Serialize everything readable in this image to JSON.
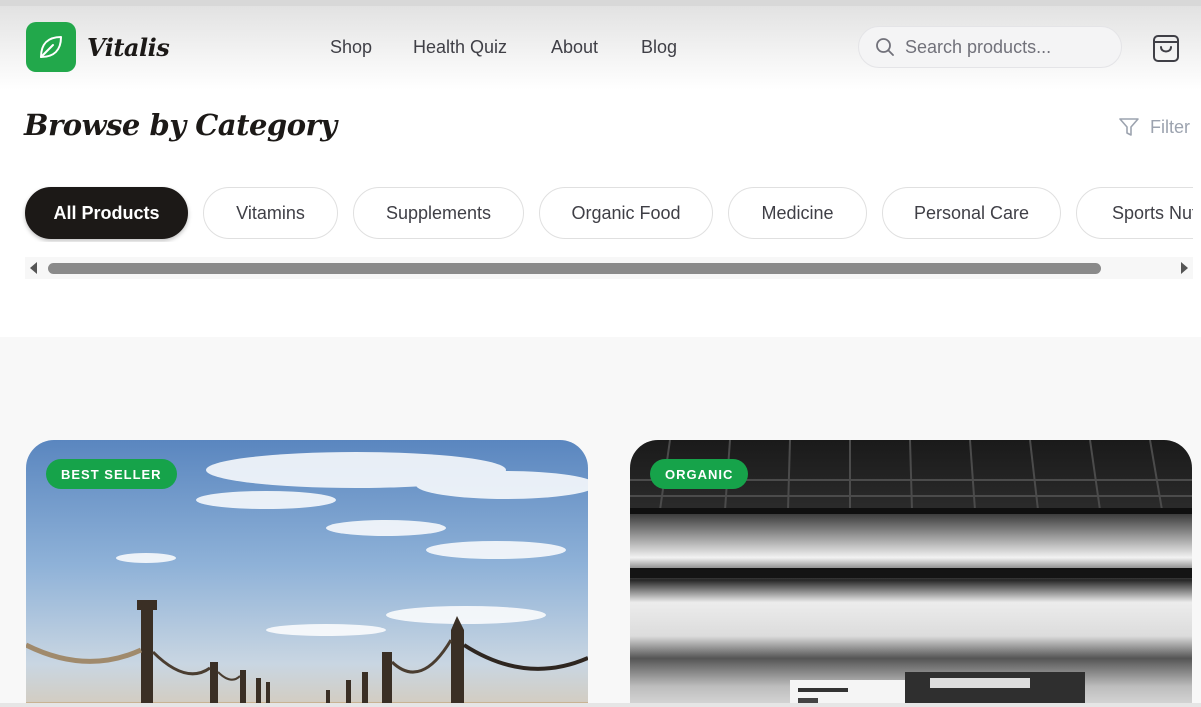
{
  "brand": {
    "name": "Vitalis",
    "logo_icon": "leaf-icon",
    "logo_color": "#22a84b"
  },
  "nav": {
    "items": [
      "Shop",
      "Health Quiz",
      "About",
      "Blog"
    ]
  },
  "search": {
    "placeholder": "Search products...",
    "value": "",
    "icon": "search-icon"
  },
  "cart": {
    "icon": "shopping-bag-icon"
  },
  "page": {
    "title": "Browse by Category"
  },
  "filter": {
    "label": "Filter",
    "icon": "funnel-icon"
  },
  "categories": {
    "items": [
      "All Products",
      "Vitamins",
      "Supplements",
      "Organic Food",
      "Medicine",
      "Personal Care",
      "Sports Nutrition"
    ],
    "active": "All Products"
  },
  "products": [
    {
      "badge": "BEST SELLER",
      "image": "pier-with-rope-posts-sky-photo"
    },
    {
      "badge": "ORGANIC",
      "image": "motion-blur-train-station-photo"
    }
  ],
  "colors": {
    "accent": "#16a34a",
    "dark": "#1c1917",
    "muted": "#9ca3af"
  }
}
